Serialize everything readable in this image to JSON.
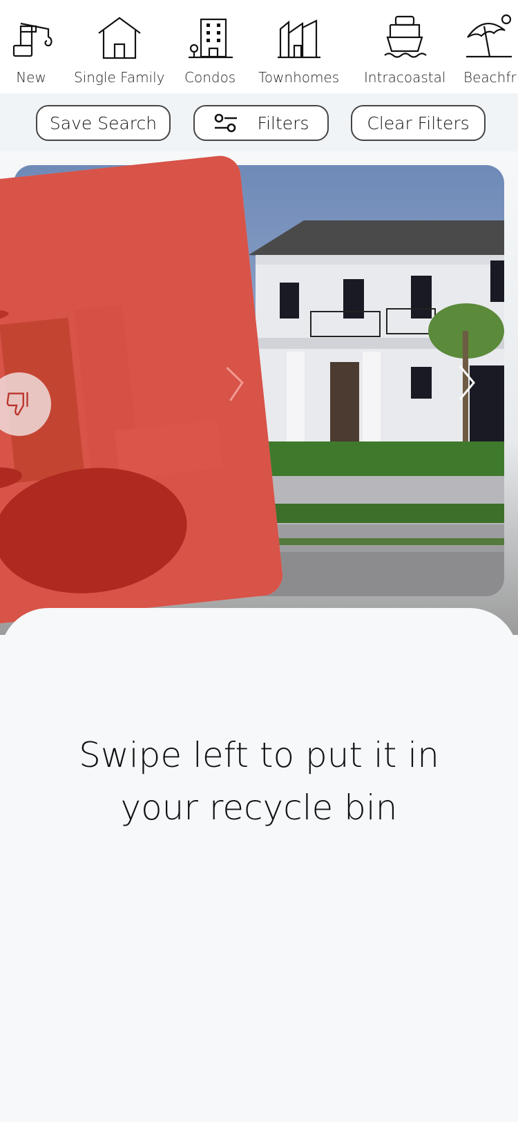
{
  "categories": [
    {
      "label": "New",
      "icon": "crane-icon"
    },
    {
      "label": "Single Family",
      "icon": "house-icon"
    },
    {
      "label": "Condos",
      "icon": "building-icon"
    },
    {
      "label": "Townhomes",
      "icon": "townhome-icon"
    },
    {
      "label": "Intracoastal",
      "icon": "boat-icon"
    },
    {
      "label": "Beachfr",
      "icon": "umbrella-icon"
    }
  ],
  "filters": {
    "save_search": "Save Search",
    "filters": "Filters",
    "clear_filters": "Clear Filters"
  },
  "swipe": {
    "overlay_color": "#d42a1e",
    "message": "Swipe left to put it in your recycle bin"
  }
}
